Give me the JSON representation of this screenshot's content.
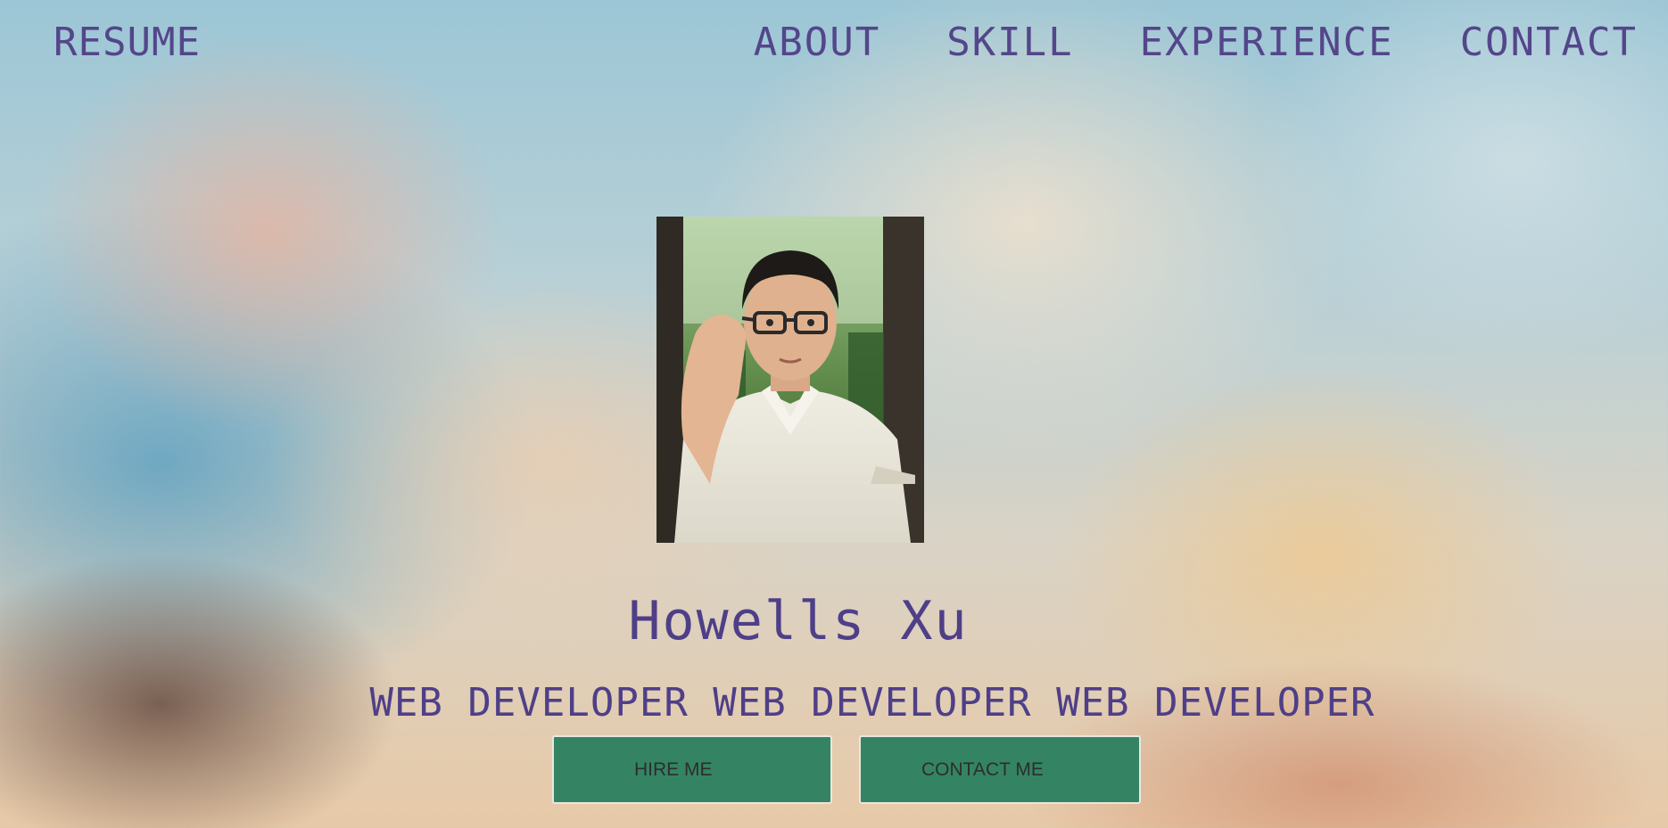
{
  "nav": {
    "brand": "RESUME",
    "links": [
      "ABOUT",
      "SKILL",
      "EXPERIENCE",
      "CONTACT"
    ]
  },
  "hero": {
    "name": "Howells Xu",
    "tagline": "WEB DEVELOPER WEB DEVELOPER WEB DEVELOPER",
    "hire_button": "HIRE ME",
    "contact_button": "CONTACT ME"
  },
  "colors": {
    "text_accent": "#54468a",
    "button_bg": "#348463"
  },
  "icons": [
    "profile-photo"
  ]
}
